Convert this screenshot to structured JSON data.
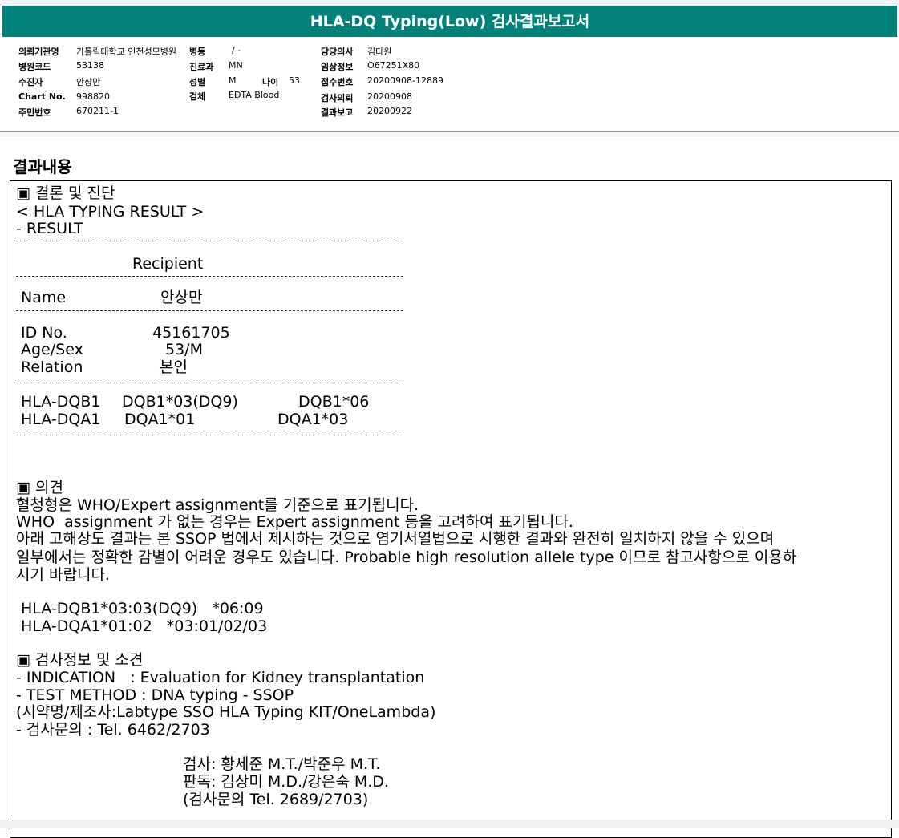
{
  "header": {
    "title": "HLA-DQ Typing(Low) 검사결과보고서"
  },
  "info": {
    "institution_label": "의뢰기관명",
    "institution_value": "가톨릭대학교 인천성모병원",
    "ward_label": "병동",
    "ward_value": "/ -",
    "doctor_label": "담당의사",
    "doctor_value": "김다원",
    "hospital_code_label": "병원코드",
    "hospital_code_value": "53138",
    "dept_label": "진료과",
    "dept_value": "MN",
    "clinical_label": "임상정보",
    "clinical_value": "O67251X80",
    "patient_label": "수진자",
    "patient_value": "안상만",
    "sex_label": "성별",
    "sex_value": "M",
    "age_label": "나이",
    "age_value": "53",
    "receipt_label": "접수번호",
    "receipt_value": "20200908-12889",
    "chart_label": "Chart No.",
    "chart_value": "998820",
    "specimen_label": "검체",
    "specimen_value": "EDTA Blood",
    "request_label": "검사의뢰",
    "request_value": "20200908",
    "id_label": "주민번호",
    "id_value": "670211-1",
    "report_label": "결과보고",
    "report_value": "20200922"
  },
  "section_title": "결과내용",
  "result": {
    "conclusion_heading": "▣ 결론 및 진단",
    "typing_heading": "< HLA TYPING RESULT >",
    "result_label": "- RESULT",
    "recipient_header": "Recipient",
    "name_label": "Name",
    "name_value": "안상만",
    "idno_label": "ID No.",
    "idno_value": "45161705",
    "agesex_label": "Age/Sex",
    "agesex_value": "53/M",
    "relation_label": "Relation",
    "relation_value": "본인",
    "dqb1_label": "HLA-DQB1",
    "dqb1_a": "DQB1*03(DQ9)",
    "dqb1_b": "DQB1*06",
    "dqa1_label": "HLA-DQA1",
    "dqa1_a": "DQA1*01",
    "dqa1_b": "DQA1*03"
  },
  "opinion": {
    "heading": "▣ 의견",
    "line1": "혈청형은 WHO/Expert assignment를 기준으로 표기됩니다.",
    "line2": "WHO  assignment 가 없는 경우는 Expert assignment 등을 고려하여 표기됩니다.",
    "line3": "아래 고해상도 결과는 본 SSOP 법에서 제시하는 것으로 염기서열법으로 시행한 결과와 완전히 일치하지 않을 수 있으며",
    "line4": "일부에서는 정확한 감별이 어려운 경우도 있습니다. Probable high resolution allele type 이므로 참고사항으로 이용하",
    "line5": "시기 바랍니다.",
    "hires1": "HLA-DQB1*03:03(DQ9)   *06:09",
    "hires2": "HLA-DQA1*01:02   *03:01/02/03"
  },
  "test_info": {
    "heading": "▣ 검사정보 및 소견",
    "indication": "- INDICATION   : Evaluation for Kidney transplantation",
    "method": "- TEST METHOD : DNA typing - SSOP",
    "reagent": "(시약명/제조사:Labtype SSO HLA Typing KIT/OneLambda)",
    "contact": "- 검사문의 : Tel. 6462/2703",
    "tester": "검사: 황세준 M.T./박준우 M.T.",
    "reader": "판독: 김상미 M.D./강은숙 M.D.",
    "tester_contact": "(검사문의 Tel. 2689/2703)"
  }
}
